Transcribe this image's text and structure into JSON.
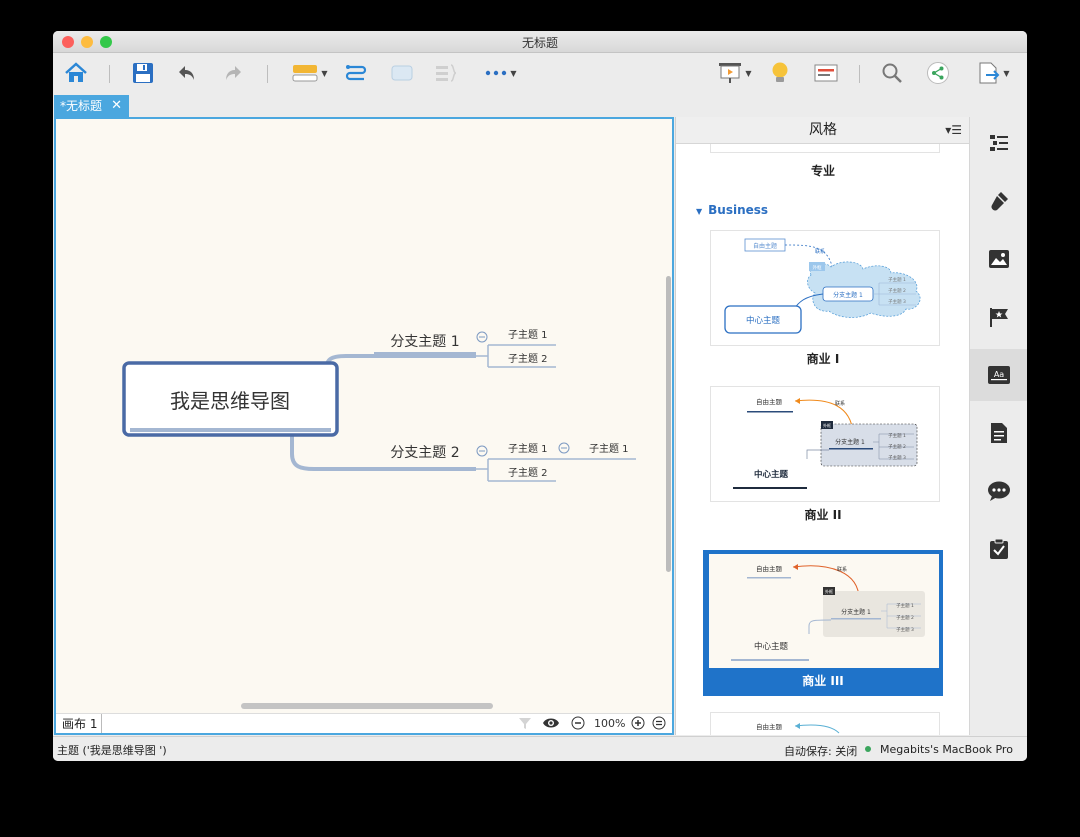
{
  "window": {
    "title": "无标题"
  },
  "toolbar": {
    "items": [
      "home-icon",
      "save-icon",
      "undo-icon",
      "redo-icon",
      "topic-icon",
      "relationship-icon",
      "boundary-icon",
      "summary-icon",
      "more-icon",
      "presentation-icon",
      "idea-icon",
      "outliner-icon",
      "search-icon",
      "share-icon",
      "export-icon"
    ]
  },
  "tab": {
    "label": "*无标题",
    "close": "✕"
  },
  "mindmap": {
    "central": "我是思维导图",
    "branches": [
      {
        "label": "分支主题 1",
        "children": [
          "子主题 1",
          "子主题 2"
        ]
      },
      {
        "label": "分支主题 2",
        "children": [
          "子主题 1",
          "子主题 2"
        ],
        "grandchild": "子主题 1"
      }
    ]
  },
  "canvas_bar": {
    "sheet": "画布 1",
    "zoom": "100%"
  },
  "panel": {
    "title": "风格",
    "prev_label": "专业",
    "section": "Business",
    "styles": [
      {
        "label": "商业 I",
        "selected": false
      },
      {
        "label": "商业 II",
        "selected": false
      },
      {
        "label": "商业 III",
        "selected": true
      }
    ],
    "thumb_text": {
      "free": "自由主题",
      "rel": "联系",
      "boundary": "外框",
      "branch": "分支主题 1",
      "sub1": "子主题 1",
      "sub2": "子主题 2",
      "sub3": "子主题 3",
      "center": "中心主题"
    }
  },
  "sidebar": {
    "items": [
      "outline-icon",
      "format-brush-icon",
      "image-icon",
      "flag-icon",
      "style-icon",
      "notes-icon",
      "comment-icon",
      "task-icon"
    ],
    "active": 4
  },
  "status": {
    "left": "主题 ('我是思维导图      ')",
    "autosave": "自动保存: 关闭",
    "device": "Megabits's MacBook Pro"
  },
  "colors": {
    "accent": "#4ba7df",
    "selected": "#1f73c9",
    "branch": "#a4b7d2",
    "central_border": "#4a6aa5",
    "canvas": "#fcf9f2"
  }
}
